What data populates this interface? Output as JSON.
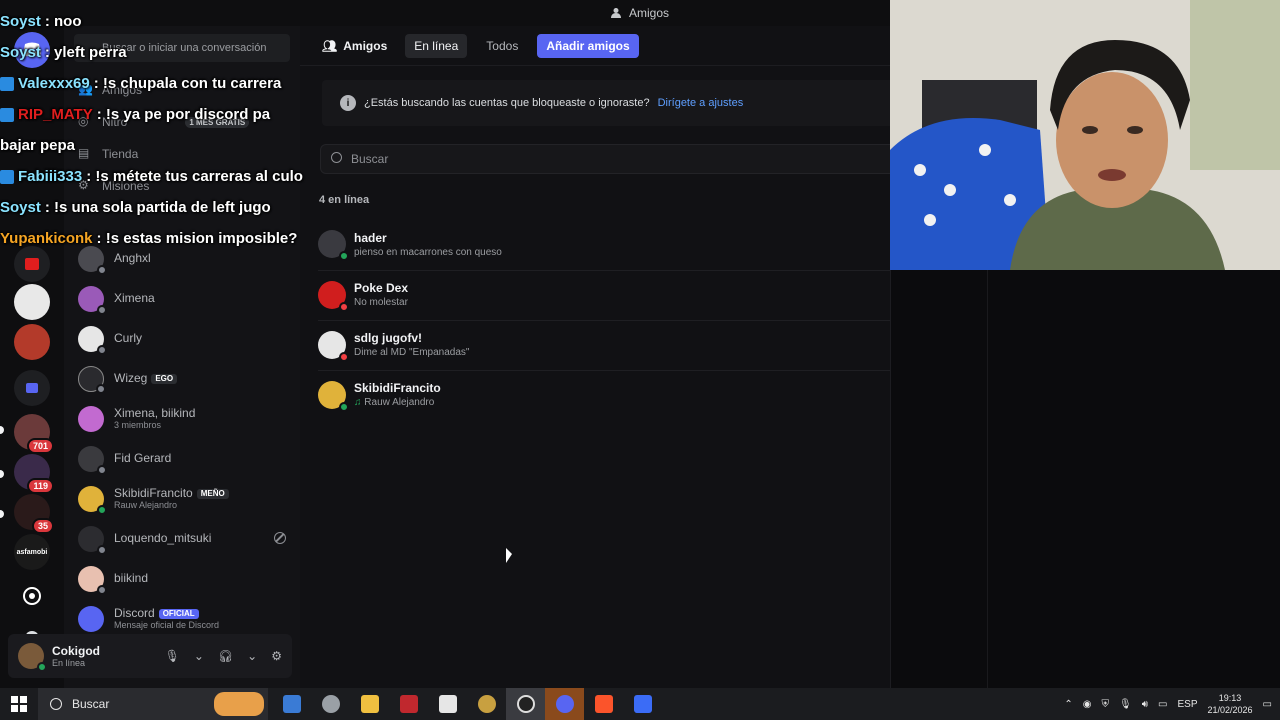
{
  "window": {
    "title": "Amigos"
  },
  "rail": {
    "badges": [
      "701",
      "119",
      "35"
    ],
    "label_text": "asfamobi"
  },
  "channels": {
    "search_placeholder": "Buscar o iniciar una conversación",
    "nav": {
      "friends": "Amigos",
      "nitro": "Nitro",
      "nitro_tag": "1 MES GRATIS",
      "shop": "Tienda",
      "quests": "Misiones"
    },
    "dms": [
      {
        "name": "Anghxl",
        "sub": "",
        "tag": ""
      },
      {
        "name": "Ximena",
        "sub": "",
        "tag": ""
      },
      {
        "name": "Curly",
        "sub": "",
        "tag": ""
      },
      {
        "name": "Wizeg",
        "sub": "",
        "tag": "EGO"
      },
      {
        "name": "Ximena, biikind",
        "sub": "3 miembros",
        "tag": ""
      },
      {
        "name": "Fid Gerard",
        "sub": "",
        "tag": ""
      },
      {
        "name": "SkibidiFrancito",
        "sub": "Rauw Alejandro",
        "tag": "MEÑO"
      },
      {
        "name": "Loquendo_mitsuki",
        "sub": "",
        "tag": ""
      },
      {
        "name": "biikind",
        "sub": "",
        "tag": ""
      },
      {
        "name": "Discord",
        "sub": "Mensaje oficial de Discord",
        "tag": "OFICIAL"
      }
    ]
  },
  "user": {
    "name": "Cokigod",
    "status": "En línea"
  },
  "main": {
    "tabs": {
      "home": "Amigos",
      "online": "En línea",
      "all": "Todos",
      "add": "Añadir amigos"
    },
    "notice": {
      "text": "¿Estás buscando las cuentas que bloqueaste o ignoraste?",
      "link": "Dirígete a ajustes"
    },
    "search_placeholder": "Buscar",
    "online_count": "4 en línea",
    "friends": [
      {
        "name": "hader",
        "sub": "pienso en macarrones con queso",
        "status": "online"
      },
      {
        "name": "Poke Dex",
        "sub": "No molestar",
        "status": "dnd"
      },
      {
        "name": "sdlg jugofv!",
        "sub": "Dime al MD \"Empanadas\"",
        "status": "dnd"
      },
      {
        "name": "SkibidiFrancito",
        "sub": "Rauw Alejandro",
        "status": "online"
      }
    ]
  },
  "chat": [
    {
      "user": "Soyst",
      "msg": ": noo",
      "color": "#8be3ff"
    },
    {
      "user": "Soyst",
      "msg": ": yleft perra",
      "color": "#8be3ff"
    },
    {
      "user": "Valexxx69",
      "msg": ": !s chupala con tu carrera",
      "color": "#8be3ff"
    },
    {
      "user": "RIP_MATY",
      "msg": ": !s ya pe por discord pa",
      "color": "#e01e1e"
    },
    {
      "user": "",
      "msg": "bajar pepa",
      "color": "#ffffff"
    },
    {
      "user": "Fabiii333",
      "msg": ": !s métete tus carreras al culo",
      "color": "#8be3ff"
    },
    {
      "user": "Soyst",
      "msg": ": !s una sola partida de left jugo",
      "color": "#8be3ff"
    },
    {
      "user": "Yupankiconk",
      "msg": ": !s estas mision imposible?",
      "color": "#f5a524"
    }
  ],
  "taskbar": {
    "search": "Buscar",
    "lang": "ESP",
    "time": "19:13",
    "date": "21/02/2026"
  },
  "colors": {
    "accent": "#5865f2",
    "online": "#23a55a",
    "dnd": "#f23f43",
    "link": "#5f9fff"
  }
}
